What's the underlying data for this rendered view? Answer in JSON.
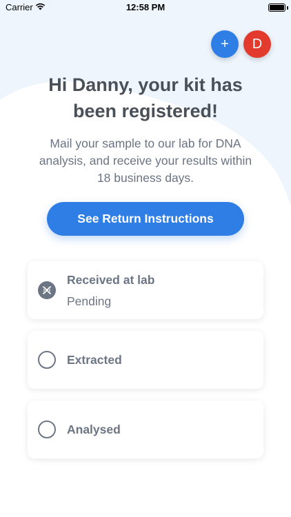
{
  "status_bar": {
    "carrier": "Carrier",
    "time": "12:58 PM"
  },
  "header": {
    "add_symbol": "+",
    "avatar_initial": "D"
  },
  "hero": {
    "headline_line1": "Hi Danny, your kit has",
    "headline_line2": "been registered!",
    "subtitle_line1": "Mail your sample to our lab for DNA",
    "subtitle_line2": "analysis, and receive your results within",
    "subtitle_line3": "18 business days."
  },
  "actions": {
    "return_instructions_label": "See Return Instructions"
  },
  "steps": [
    {
      "title": "Received at lab",
      "status": "Pending",
      "icon": "dna-icon"
    },
    {
      "title": "Extracted",
      "icon": "empty-circle-icon"
    },
    {
      "title": "Analysed",
      "icon": "empty-circle-icon"
    }
  ],
  "colors": {
    "primary": "#2f7ee6",
    "avatar": "#e23a2c",
    "text_muted": "#6c7584",
    "background_tint": "#eef5fd"
  }
}
